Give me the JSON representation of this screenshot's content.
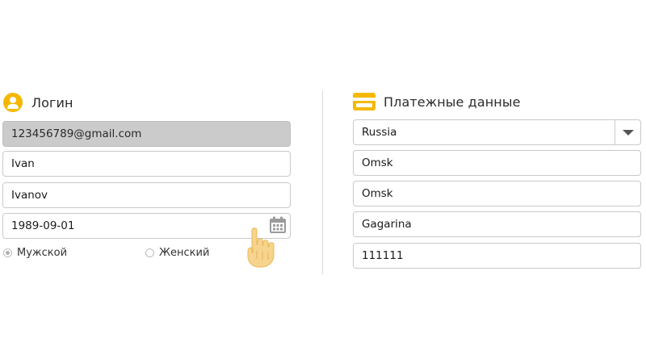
{
  "login": {
    "title": "Логин",
    "email": "123456789@gmail.com",
    "first_name": "Ivan",
    "last_name": "Ivanov",
    "birth_date": "1989-09-01",
    "gender": {
      "male_label": "Мужской",
      "female_label": "Женский",
      "selected": "male"
    }
  },
  "payment": {
    "title": "Платежные данные",
    "country": "Russia",
    "region": "Omsk",
    "city": "Omsk",
    "street": "Gagarina",
    "postal_code": "111111"
  },
  "colors": {
    "accent": "#f5b800",
    "disabled_field": "#cbcbcb",
    "border": "#c9c9c9",
    "cursor_hand": "#f7d48d"
  },
  "icons": {
    "login": "user-icon",
    "payment": "credit-card-icon",
    "date": "calendar-icon",
    "select": "caret-down-icon",
    "cursor": "hand-pointer-icon"
  }
}
